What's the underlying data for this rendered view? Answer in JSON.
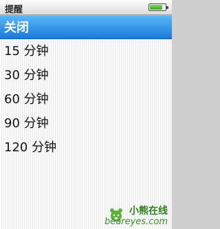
{
  "header": {
    "title": "提醒",
    "battery_level": 0.85,
    "battery_color": "#3ea81d"
  },
  "menu": {
    "selected_color": "#1a79d9",
    "items": [
      {
        "label": "关闭",
        "selected": true
      },
      {
        "label": "15 分钟",
        "selected": false
      },
      {
        "label": "30 分钟",
        "selected": false
      },
      {
        "label": "60 分钟",
        "selected": false
      },
      {
        "label": "90 分钟",
        "selected": false
      },
      {
        "label": "120 分钟",
        "selected": false
      }
    ]
  },
  "watermark": {
    "name": "小熊在线",
    "site": "beareyes.com"
  }
}
